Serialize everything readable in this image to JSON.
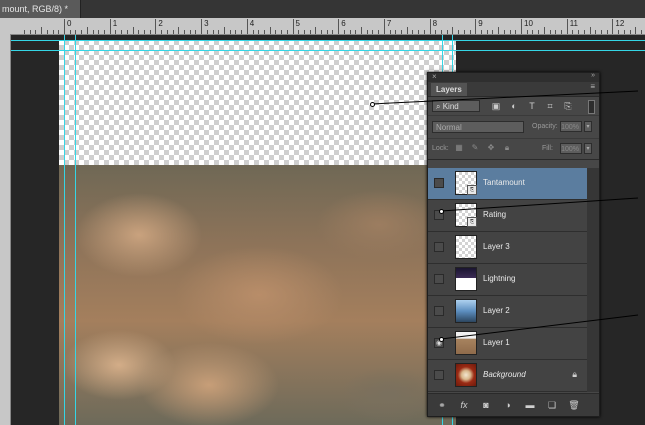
{
  "document": {
    "tab_label": "mount, RGB/8) *"
  },
  "ruler": {
    "marks": [
      "0",
      "1",
      "2",
      "3",
      "4",
      "5",
      "6",
      "7",
      "8",
      "9",
      "10",
      "11",
      "12"
    ]
  },
  "colors": {
    "guide": "#35d6e6",
    "selected_row": "#5b7d9f",
    "panel_bg": "#474747"
  },
  "layers_panel": {
    "close_icon": "×",
    "collapse_icon": "»",
    "tab_label": "Layers",
    "menu_icon": "≡",
    "filter": {
      "kind_label": "Kind",
      "icons": [
        "pixel-layer-filter-icon",
        "adjustment-layer-filter-icon",
        "type-layer-filter-icon",
        "shape-layer-filter-icon",
        "smart-object-filter-icon"
      ]
    },
    "blend_mode": "Normal",
    "opacity_label": "Opacity:",
    "opacity_value": "100%",
    "lock_label": "Lock:",
    "fill_label": "Fill:",
    "fill_value": "100%",
    "layers": [
      {
        "name": "Tantamount",
        "selected": true,
        "thumb": "transparent",
        "smart_object": true,
        "visible": false
      },
      {
        "name": "Rating",
        "selected": false,
        "thumb": "transparent",
        "smart_object": true,
        "visible": false
      },
      {
        "name": "Layer 3",
        "selected": false,
        "thumb": "transparent",
        "smart_object": false,
        "visible": false
      },
      {
        "name": "Lightning",
        "selected": false,
        "thumb": "lightning",
        "smart_object": false,
        "visible": false
      },
      {
        "name": "Layer 2",
        "selected": false,
        "thumb": "layer2",
        "smart_object": false,
        "visible": false
      },
      {
        "name": "Layer 1",
        "selected": false,
        "thumb": "layer1",
        "smart_object": false,
        "visible": true
      },
      {
        "name": "Background",
        "selected": false,
        "thumb": "bg",
        "smart_object": false,
        "visible": false,
        "locked": true
      }
    ],
    "bottom_icons": [
      "link-layers-icon",
      "fx-icon",
      "add-mask-icon",
      "adjustment-layer-icon",
      "new-group-icon",
      "new-layer-icon",
      "trash-icon"
    ]
  }
}
